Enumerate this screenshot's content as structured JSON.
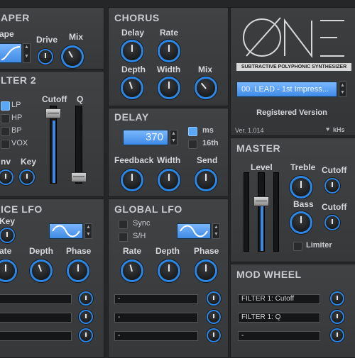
{
  "shaper": {
    "title": "APER",
    "shape_label": "ape",
    "drive_label": "Drive",
    "mix_label": "Mix"
  },
  "filter2": {
    "title": "LTER 2",
    "modes": [
      "LP",
      "HP",
      "BP",
      "VOX"
    ],
    "cutoff_label": "Cutoff",
    "q_label": "Q",
    "env_label": "nv",
    "key_label": "Key"
  },
  "voice_lfo": {
    "title": "ICE LFO",
    "key_label": "Key",
    "rate_label": "ate",
    "depth_label": "Depth",
    "phase_label": "Phase"
  },
  "chorus": {
    "title": "CHORUS",
    "delay_label": "Delay",
    "rate_label": "Rate",
    "depth_label": "Depth",
    "width_label": "Width",
    "mix_label": "Mix"
  },
  "delay": {
    "title": "DELAY",
    "time_value": "370",
    "ms_label": "ms",
    "sixteenth_label": "16th",
    "feedback_label": "Feedback",
    "width_label": "Width",
    "send_label": "Send"
  },
  "global_lfo": {
    "title": "GLOBAL LFO",
    "sync_label": "Sync",
    "sh_label": "S/H",
    "rate_label": "Rate",
    "depth_label": "Depth",
    "phase_label": "Phase",
    "slot_text": "-"
  },
  "brand": {
    "logo": "ONE",
    "subtitle": "SUBTRACTIVE POLYPHONIC SYNTHESIZER",
    "preset": "00. LEAD - 1st Impress...",
    "registered": "Registered Version",
    "version": "Ver. 1.014",
    "maker": "kHs"
  },
  "master": {
    "title": "MASTER",
    "level_label": "Level",
    "treble_label": "Treble",
    "cutoff_label": "Cutoff",
    "bass_label": "Bass",
    "cutoff2_label": "Cutoff",
    "limiter_label": "Limiter"
  },
  "mod_wheel": {
    "title": "MOD WHEEL",
    "slots": [
      "FILTER 1: Cutoff",
      "FILTER 1: Q",
      "-"
    ]
  },
  "accent_color": "#2c86e6"
}
